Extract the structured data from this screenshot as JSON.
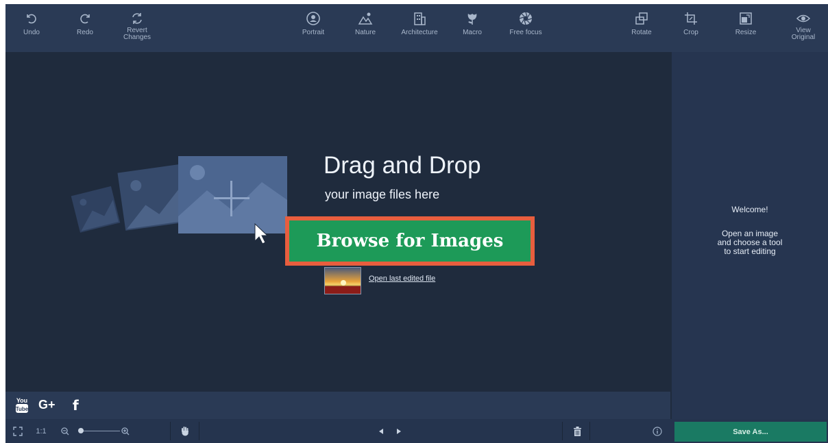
{
  "toolbar": {
    "undo": {
      "label": "Undo",
      "icon": "undo-icon"
    },
    "redo": {
      "label": "Redo",
      "icon": "redo-icon"
    },
    "revert": {
      "label": "Revert\nChanges",
      "icon": "revert-icon"
    },
    "portrait": {
      "label": "Portrait",
      "icon": "portrait-icon"
    },
    "nature": {
      "label": "Nature",
      "icon": "nature-icon"
    },
    "architecture": {
      "label": "Architecture",
      "icon": "architecture-icon"
    },
    "macro": {
      "label": "Macro",
      "icon": "macro-icon"
    },
    "free_focus": {
      "label": "Free focus",
      "icon": "free-focus-icon"
    },
    "rotate": {
      "label": "Rotate",
      "icon": "rotate-icon"
    },
    "crop": {
      "label": "Crop",
      "icon": "crop-icon"
    },
    "resize": {
      "label": "Resize",
      "icon": "resize-icon"
    },
    "view_original": {
      "label": "View\nOriginal",
      "icon": "eye-icon"
    }
  },
  "canvas": {
    "title": "Drag and Drop",
    "subtitle": "your image files here",
    "browse_label": "Browse for Images",
    "last_file_label": "Open last edited file"
  },
  "side_panel": {
    "welcome_title": "Welcome!",
    "welcome_body": "Open an image\nand choose a tool\nto start editing"
  },
  "social": {
    "youtube": "You\nTube",
    "gplus": "G+",
    "facebook": "f"
  },
  "bottom": {
    "zoom_ratio": "1:1",
    "save_label": "Save As..."
  },
  "colors": {
    "background": "#1f2b3d",
    "toolbar": "#2a3a55",
    "browse_button": "#1d9a58",
    "browse_highlight": "#e85e3e",
    "save_button": "#1a7a63"
  }
}
